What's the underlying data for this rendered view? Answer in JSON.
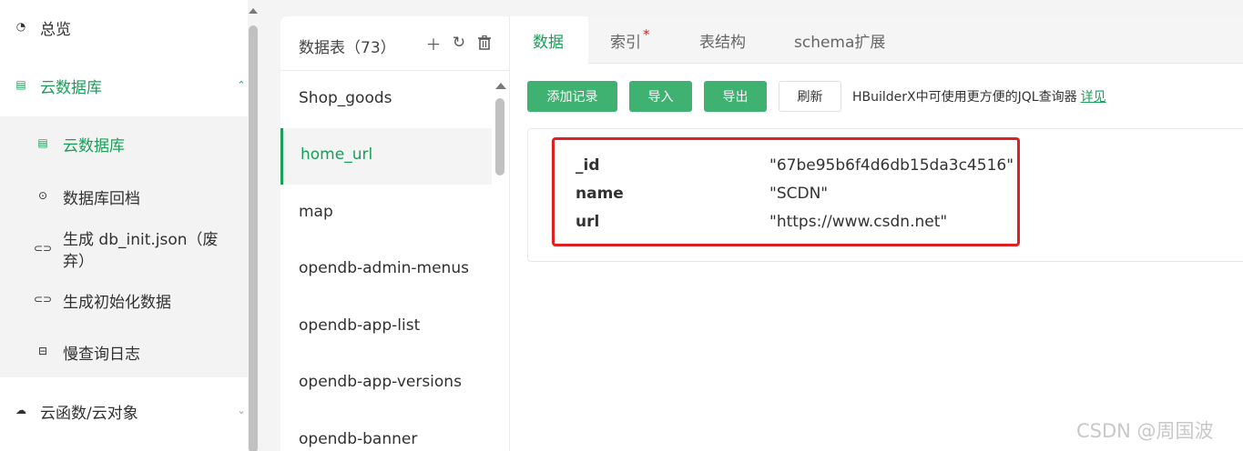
{
  "sidebar": {
    "overview": {
      "label": "总览",
      "icon": "pie-chart-icon"
    },
    "cloud_db": {
      "label": "云数据库",
      "icon": "database-icon",
      "expanded": true
    },
    "sub_items": [
      {
        "label": "云数据库",
        "icon": "list-icon",
        "active": true
      },
      {
        "label": "数据库回档",
        "icon": "rollback-icon"
      },
      {
        "label": "生成 db_init.json（废弃）",
        "label_line1": "生成 db_init.json（废",
        "label_line2": "弃）",
        "icon": "link-icon"
      },
      {
        "label": "生成初始化数据",
        "icon": "link-icon"
      },
      {
        "label": "慢查询日志",
        "icon": "log-icon"
      }
    ],
    "cloud_func": {
      "label": "云函数/云对象",
      "icon": "cloud-icon"
    }
  },
  "tables_panel": {
    "title": "数据表（73）",
    "items": [
      "Shop_goods",
      "home_url",
      "map",
      "opendb-admin-menus",
      "opendb-app-list",
      "opendb-app-versions",
      "opendb-banner"
    ],
    "active": "home_url"
  },
  "tabs": [
    {
      "label": "数据",
      "active": true
    },
    {
      "label": "索引",
      "modified": true,
      "star": "*"
    },
    {
      "label": "表结构"
    },
    {
      "label": "schema扩展"
    }
  ],
  "toolbar": {
    "add_record": "添加记录",
    "import": "导入",
    "export": "导出",
    "refresh": "刷新",
    "hint": "HBuilderX中可使用更方便的JQL查询器",
    "hint_link": "详见"
  },
  "record": [
    {
      "key": "_id",
      "value": "\"67be95b6f4d6db15da3c4516\""
    },
    {
      "key": "name",
      "value": "\"SCDN\""
    },
    {
      "key": "url",
      "value": "\"https://www.csdn.net\""
    }
  ],
  "colors": {
    "accent": "#18a058",
    "button_green": "#3fb271",
    "highlight_red": "#e02020"
  },
  "watermark": "CSDN @周国波"
}
